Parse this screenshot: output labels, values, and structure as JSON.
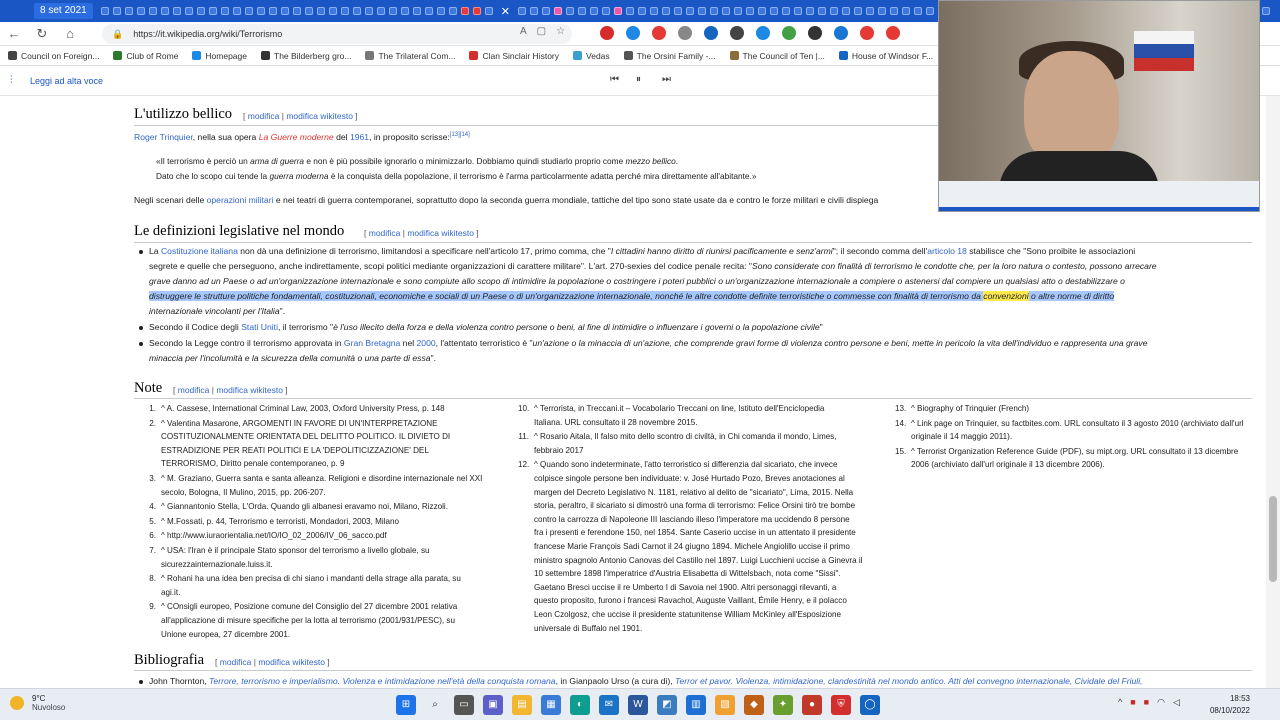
{
  "browser": {
    "active_tab_label": "8 set 2021",
    "url": "https://it.wikipedia.org/wiki/Terrorismo",
    "bookmarks": [
      "Council on Foreign...",
      "Club of Rome",
      "Homepage",
      "The Bilderberg gro...",
      "The Trilateral Com...",
      "Clan Sinclair History",
      "Vedas",
      "The Orsini Family -...",
      "The Council of Ten |...",
      "House of Windsor F...",
      "Perché"
    ]
  },
  "reader": {
    "label": "Leggi ad alta voce"
  },
  "sections": {
    "bellico": {
      "title": "L'utilizzo bellico",
      "edit": "modifica",
      "edit_wiki": "modifica wikitesto",
      "intro_link": "Roger Trinquier",
      "intro_a": ", nella sua opera ",
      "intro_book": "La Guerre moderne",
      "intro_b": " del ",
      "intro_year": "1961",
      "intro_c": ", in proposito scrisse:",
      "intro_ref": "[13][14]",
      "quote1_a": "«Il terrorismo è perciò un ",
      "quote1_b": "arma di guerra",
      "quote1_c": " e non è più possibile ignorarlo o minimizzarlo. Dobbiamo quindi studiarlo proprio come ",
      "quote1_d": "mezzo bellico",
      "quote1_e": ".",
      "quote2_a": "Dato che lo scopo cui tende la ",
      "quote2_b": "guerra moderna",
      "quote2_c": " è la conquista della popolazione, il terrorismo è l'arma particolarmente adatta perché mira direttamente all'abitante.»",
      "scen_a": "Negli scenari delle ",
      "scen_link": "operazioni militari",
      "scen_b": " e nei teatri di guerra contemporanei, soprattutto dopo la seconda guerra mondiale, tattiche del tipo sono state usate da e contro le forze militari e civili dispiega"
    },
    "definizioni": {
      "title": "Le definizioni legislative nel mondo",
      "b1_l1_a": "La ",
      "b1_l1_link": "Costituzione italiana",
      "b1_l1_b": " non dà una definizione di terrorismo, limitandosi a specificare nell'articolo 17, primo comma, che \"",
      "b1_l1_c": "I cittadini hanno diritto di riunirsi pacificamente e senz'armi",
      "b1_l1_d": "\"; il secondo comma dell'",
      "b1_l1_link2": "articolo 18",
      "b1_l1_e": " stabilisce che \"Sono proibite le associazioni",
      "b1_l2_a": "segrete e quelle che perseguono, anche indirettamente, scopi politici mediante organizzazioni di carattere militare\". L'art. 270-sexies del codice penale recita: \"",
      "b1_l2_b": "Sono considerate con finalità di terrorismo le condotte che, per la loro natura o contesto, possono arrecare",
      "b1_l3": "grave danno ad un Paese o ad un'organizzazione internazionale e sono compiute allo scopo di intimidire la popolazione o costringere i poteri pubblici o un'organizzazione internazionale a compiere o astenersi dal compiere un qualsiasi atto o destabilizzare o",
      "b1_l4_a": "distruggere le strutture politiche fondamentali, costituzionali, economiche e sociali di un Paese o di un'organizzazione internazionale, nonché le altre condotte definite terroristiche o commesse con finalità di terrorismo da ",
      "b1_l4_hl": "convenzioni",
      "b1_l4_b": " o altre norme di diritto",
      "b1_l5": "internazionale vincolanti per l'Italia",
      "b1_l5_end": "\".",
      "b2_a": "Secondo il Codice degli ",
      "b2_link": "Stati Uniti",
      "b2_b": ", il terrorismo \"",
      "b2_c": "è l'uso illecito della forza e della violenza contro persone o beni, al fine di intimidire o influenzare i governi o la popolazione civile",
      "b2_d": "\"",
      "b3_a": "Secondo la Legge contro il terrorismo approvata in ",
      "b3_link": "Gran Bretagna",
      "b3_b": " nel ",
      "b3_year": "2000",
      "b3_c": ", l'attentato terroristico è \"",
      "b3_d": "un'azione o la minaccia di un'azione, che comprende gravi forme di violenza contro persone e beni, mette in pericolo la vita dell'individuo e rappresenta una grave",
      "b3_e": "minaccia per l'incolumità e la sicurezza della comunità o una parte di essa",
      "b3_f": "\"."
    },
    "note": {
      "title": "Note"
    },
    "bibliografia": {
      "title": "Bibliografia",
      "first_a": "John Thornton, ",
      "first_b": "Terrore, terrorismo e imperialismo. Violenza e intimidazione nell'età della conquista romana",
      "first_c": ", in Gianpaolo Urso (a cura di), ",
      "first_d": "Terror et pavor. Violenza, intimidazione, clandestinità nel mondo antico. Atti del convegno internazionale, Cividale del Friuli,"
    }
  },
  "notes_col1": [
    {
      "n": "1.",
      "lines": [
        "^ A. Cassese, International Criminal Law, 2003, Oxford University Press, p. 148"
      ]
    },
    {
      "n": "2.",
      "lines": [
        "^ Valentina Masarone, ARGOMENTI IN FAVORE DI UN'INTERPRETAZIONE",
        "COSTITUZIONALMENTE ORIENTATA DEL DELITTO POLITICO. IL DIVIETO DI",
        "ESTRADIZIONE PER REATI POLITICI E LA 'DEPOLITICIZZAZIONE' DEL",
        "TERRORISMO, Diritto penale contemporaneo, p. 9"
      ]
    },
    {
      "n": "3.",
      "lines": [
        "^ M. Graziano, Guerra santa e santa alleanza. Religioni e disordine internazionale nel XXI",
        "secolo, Bologna, Il Mulino, 2015, pp. 206-207."
      ]
    },
    {
      "n": "4.",
      "lines": [
        "^ Giannantonio Stella, L'Orda. Quando gli albanesi eravamo noi, Milano, Rizzoli."
      ]
    },
    {
      "n": "5.",
      "lines": [
        "^ M.Fossati, p. 44, Terrorismo e terroristi, Mondadori, 2003, Milano"
      ]
    },
    {
      "n": "6.",
      "lines": [
        "^ http://www.iuraorientalia.net/IO/IO_02_2006/IV_06_sacco.pdf"
      ]
    },
    {
      "n": "7.",
      "lines": [
        "^ USA: l'Iran è il principale Stato sponsor del terrorismo a livello globale, su",
        "sicurezzainternazionale.luiss.it."
      ]
    },
    {
      "n": "8.",
      "lines": [
        "^ Rohani ha una idea ben precisa di chi siano i mandanti della strage alla parata, su",
        "agi.it."
      ]
    },
    {
      "n": "9.",
      "lines": [
        "^ COnsigli europeo, Posizione comune del Consiglio del 27 dicembre 2001 relativa",
        "all'applicazione di misure specifiche per la lotta al terrorismo (2001/931/PESC), su",
        "Unione europea, 27 dicembre 2001."
      ]
    }
  ],
  "notes_col2": [
    {
      "n": "10.",
      "lines": [
        "^ Terrorista, in Treccani.it – Vocabolario Treccani on line, Istituto dell'Enciclopedia",
        "Italiana. URL consultato il 28 novembre 2015."
      ]
    },
    {
      "n": "11.",
      "lines": [
        "^ Rosario Aitala, Il falso mito dello scontro di civiltà, in Chi comanda il mondo, Limes,",
        "febbraio 2017"
      ]
    },
    {
      "n": "12.",
      "lines": [
        "^ Quando sono indeterminate, l'atto terroristico si differenzia dal sicariato, che invece",
        "colpisce singole persone ben individuate: v. José Hurtado Pozo, Breves anotaciones al",
        "margen del Decreto Legislativo N. 1181, relativo al delito de \"sicariato\", Lima, 2015. Nella",
        "storia, peraltro, il sicariato si dimostrò una forma di terrorismo: Felice Orsini tirò tre bombe",
        "contro la carrozza di Napoleone III lasciando illeso l'imperatore ma uccidendo 8 persone",
        "fra i presenti e ferendone 150, nel 1854. Sante Caserio uccise in un attentato il presidente",
        "francese Marie François Sadi Carnot il 24 giugno 1894. Michele Angiolillo uccise il primo",
        "ministro spagnolo Antonio Canovas del Castillo nel 1897. Luigi Lucchieni uccise a Ginevra il",
        "10 settembre 1898 l'imperatrice d'Austria Elisabetta di Wittelsbach, nota come \"Sissi\".",
        "Gaetano Bresci uccise il re Umberto I di Savoia nel 1900. Altri personaggi rilevanti, a",
        "questo proposito, furono i francesi Ravachol, Auguste Vaillant, Émile Henry, e il polacco",
        "Leon Czolgosz, che uccise il presidente statunitense William McKinley all'Esposizione",
        "universale di Buffalo nel 1901."
      ]
    }
  ],
  "notes_col3": [
    {
      "n": "13.",
      "lines": [
        "^ Biography of Trinquier (French)"
      ]
    },
    {
      "n": "14.",
      "lines": [
        "^ Link page on Trinquier, su factbites.com. URL consultato il 3 agosto 2010 (archiviato dall'url",
        "originale il 14 maggio 2011)."
      ]
    },
    {
      "n": "15.",
      "lines": [
        "^ Terrorist Organization Reference Guide (PDF), su mipt.org. URL consultato il 13 dicembre",
        "2006 (archiviato dall'url originale il 13 dicembre 2006)."
      ]
    }
  ],
  "taskbar": {
    "temp": "9°C",
    "weather": "Nuvoloso",
    "time": "18:53",
    "date": "08/10/2022"
  },
  "colors": {
    "link": "#3366cc",
    "red_link": "#dd3333",
    "tab_strip": "#1a56c4"
  }
}
